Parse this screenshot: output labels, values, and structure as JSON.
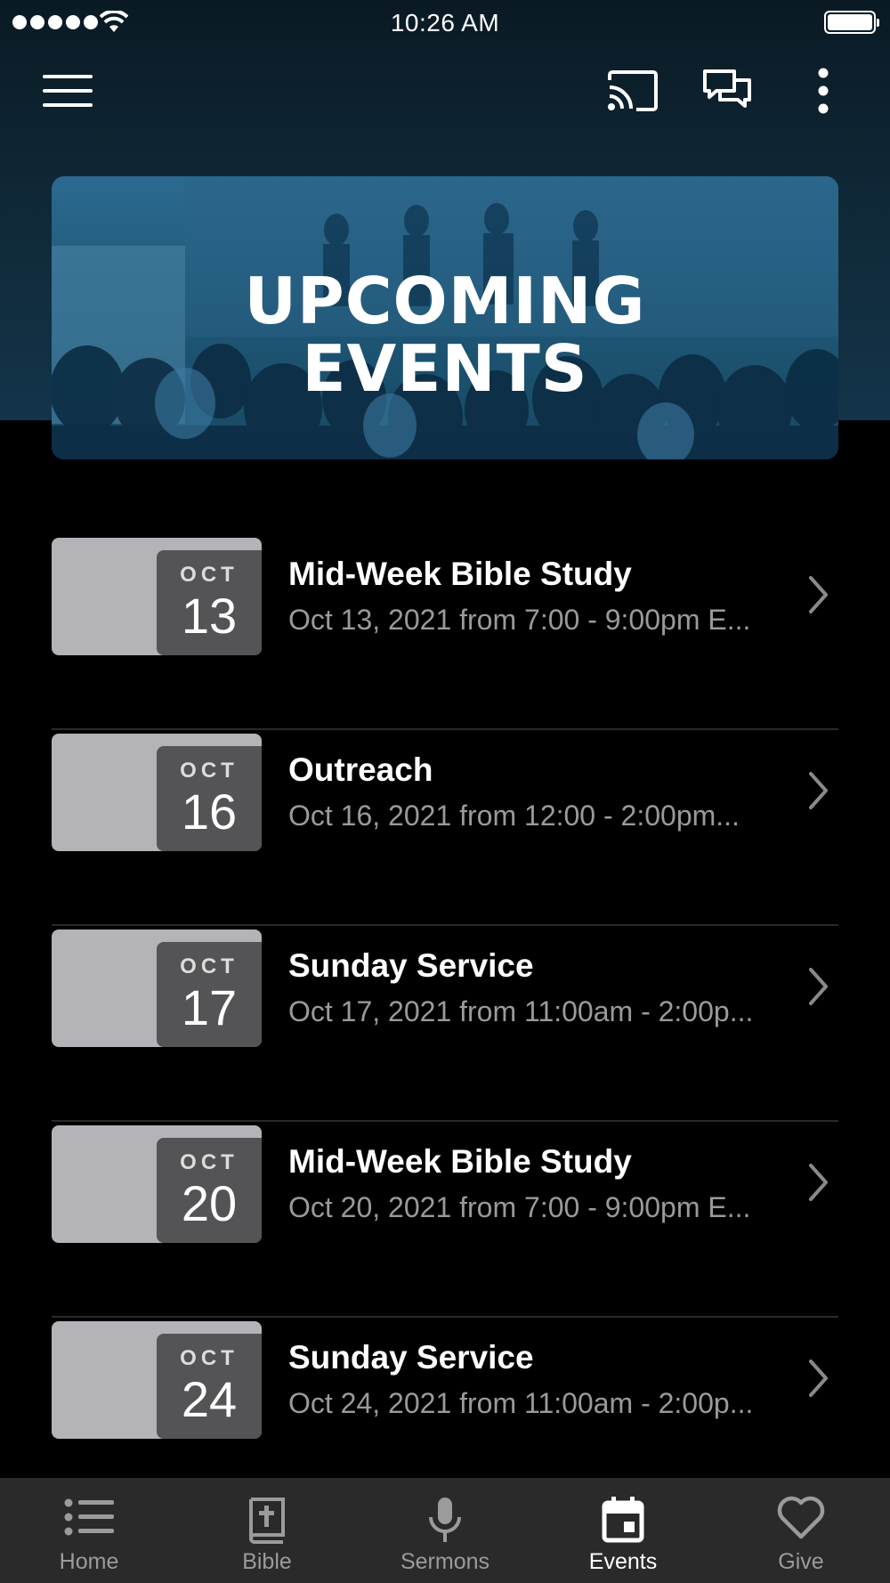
{
  "status_bar": {
    "time": "10:26 AM"
  },
  "app_bar": {
    "icons": [
      "menu-icon",
      "cast-icon",
      "chat-icon",
      "more-vertical-icon"
    ]
  },
  "banner": {
    "title_line1": "UPCOMING",
    "title_line2": "EVENTS"
  },
  "events": [
    {
      "month": "OCT",
      "day": "13",
      "title": "Mid-Week Bible Study",
      "subtitle": "Oct 13, 2021 from 7:00 - 9:00pm E..."
    },
    {
      "month": "OCT",
      "day": "16",
      "title": "Outreach",
      "subtitle": "Oct 16, 2021 from 12:00 - 2:00pm..."
    },
    {
      "month": "OCT",
      "day": "17",
      "title": "Sunday Service",
      "subtitle": "Oct 17, 2021 from 11:00am - 2:00p..."
    },
    {
      "month": "OCT",
      "day": "20",
      "title": "Mid-Week Bible Study",
      "subtitle": "Oct 20, 2021 from 7:00 - 9:00pm E..."
    },
    {
      "month": "OCT",
      "day": "24",
      "title": "Sunday Service",
      "subtitle": "Oct 24, 2021 from 11:00am - 2:00p..."
    }
  ],
  "tabs": [
    {
      "label": "Home",
      "icon": "list-icon",
      "active": false
    },
    {
      "label": "Bible",
      "icon": "bible-icon",
      "active": false
    },
    {
      "label": "Sermons",
      "icon": "microphone-icon",
      "active": false
    },
    {
      "label": "Events",
      "icon": "calendar-icon",
      "active": true
    },
    {
      "label": "Give",
      "icon": "heart-icon",
      "active": false
    }
  ],
  "colors": {
    "background": "#000000",
    "header_gradient": "#13344a",
    "banner_tint": "#1f5878",
    "date_badge": "#545456",
    "thumb": "#b3b3b8",
    "tab_bar": "#2a2a2b",
    "muted_text": "#9a9a9a"
  }
}
